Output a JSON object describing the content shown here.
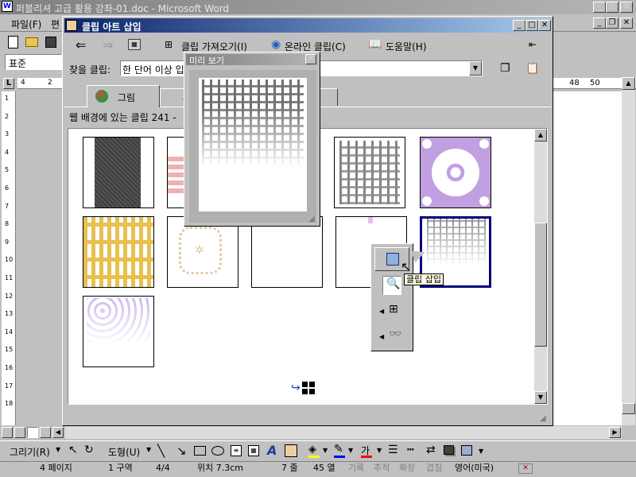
{
  "word": {
    "title": "퍼블리셔 고급 활용 강좌-01.doc - Microsoft Word",
    "menu": [
      "파일(F)",
      "편"
    ],
    "style_box": "표준",
    "ruler_left": "4",
    "ruler_mid": "2",
    "ruler_right_1": "48",
    "ruler_right_2": "50",
    "vruler_numbers": [
      "1",
      "2",
      "3",
      "4",
      "5",
      "6",
      "7",
      "8",
      "9",
      "10",
      "11",
      "12",
      "13",
      "14",
      "15",
      "16",
      "17",
      "18"
    ],
    "draw_toolbar": {
      "draw": "그리기(R)",
      "autoshapes": "도형(U)"
    },
    "status": {
      "page": "4 페이지",
      "section": "1 구역",
      "pages": "4/4",
      "position": "위치 7.3cm",
      "line": "7 줄",
      "column": "45 열",
      "rec": "기록",
      "trk": "추적",
      "ext": "확장",
      "ovr": "겹침",
      "lang": "영어(미국)"
    }
  },
  "dialog": {
    "title": "클립 아트 삽입",
    "toolbar": {
      "import": "클립 가져오기(I)",
      "online": "온라인 클립(C)",
      "help": "도움말(H)"
    },
    "search_label": "찾을 클립:",
    "search_value": "한 단어 이상 입",
    "tabs": {
      "pictures": "그림"
    },
    "result_info": "웹 배경에 있는 클립 241 -",
    "preview_title": "미리 보기",
    "tooltip": "클립 삽입"
  },
  "colors": {
    "title_active": "#0a246a",
    "selection": "#000080",
    "face": "#c0c0c0"
  }
}
